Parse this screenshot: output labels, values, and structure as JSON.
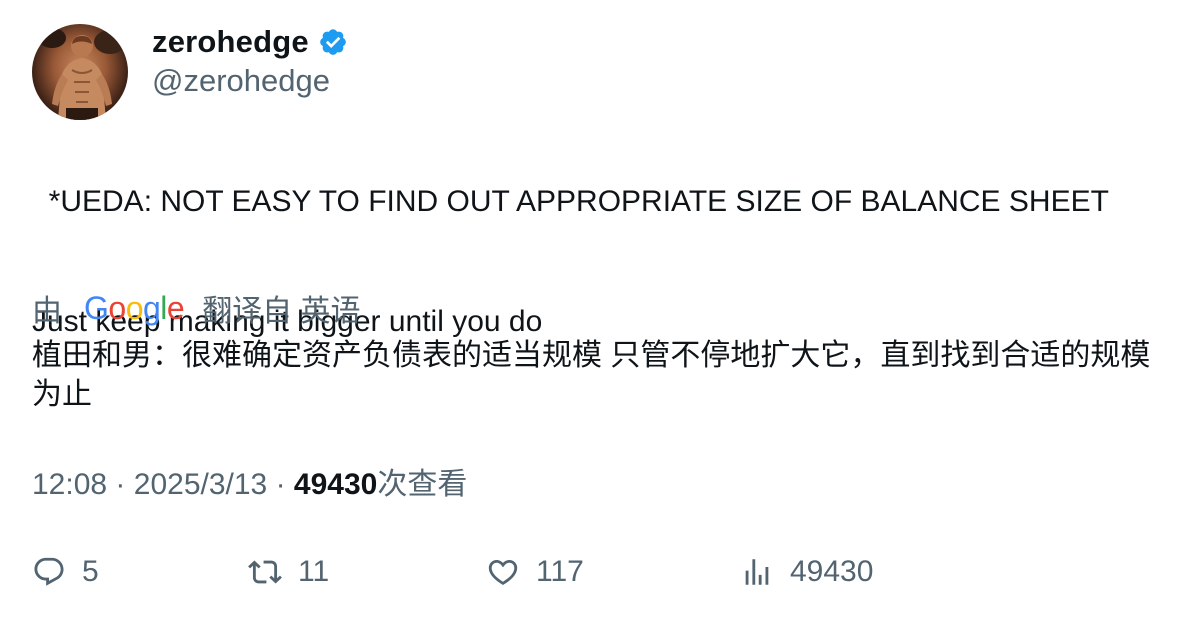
{
  "author": {
    "display_name": "zerohedge",
    "handle": "@zerohedge",
    "verified": true,
    "verified_color": "#1d9bf0",
    "avatar_icon": "avatar-photo"
  },
  "tweet": {
    "text_line1": "*UEDA: NOT EASY TO FIND OUT APPROPRIATE SIZE OF BALANCE SHEET",
    "text_line2": "Just keep making it bigger until you do"
  },
  "translation": {
    "prefix": "由",
    "provider": "Google",
    "suffix": "翻译自 英语",
    "text": "植田和男：很难确定资产负债表的适当规模 只管不停地扩大它，直到找到合适的规模为止"
  },
  "meta": {
    "time": "12:08",
    "separator": "·",
    "date": "2025/3/13",
    "views": "49430",
    "views_label": "次查看"
  },
  "actions": {
    "replies": "5",
    "retweets": "11",
    "likes": "117",
    "views": "49430"
  },
  "colors": {
    "text": "#0f1419",
    "secondary": "#536471",
    "google_blue": "#4285F4",
    "google_red": "#EA4335",
    "google_yellow": "#FBBC05",
    "google_green": "#34A853"
  }
}
